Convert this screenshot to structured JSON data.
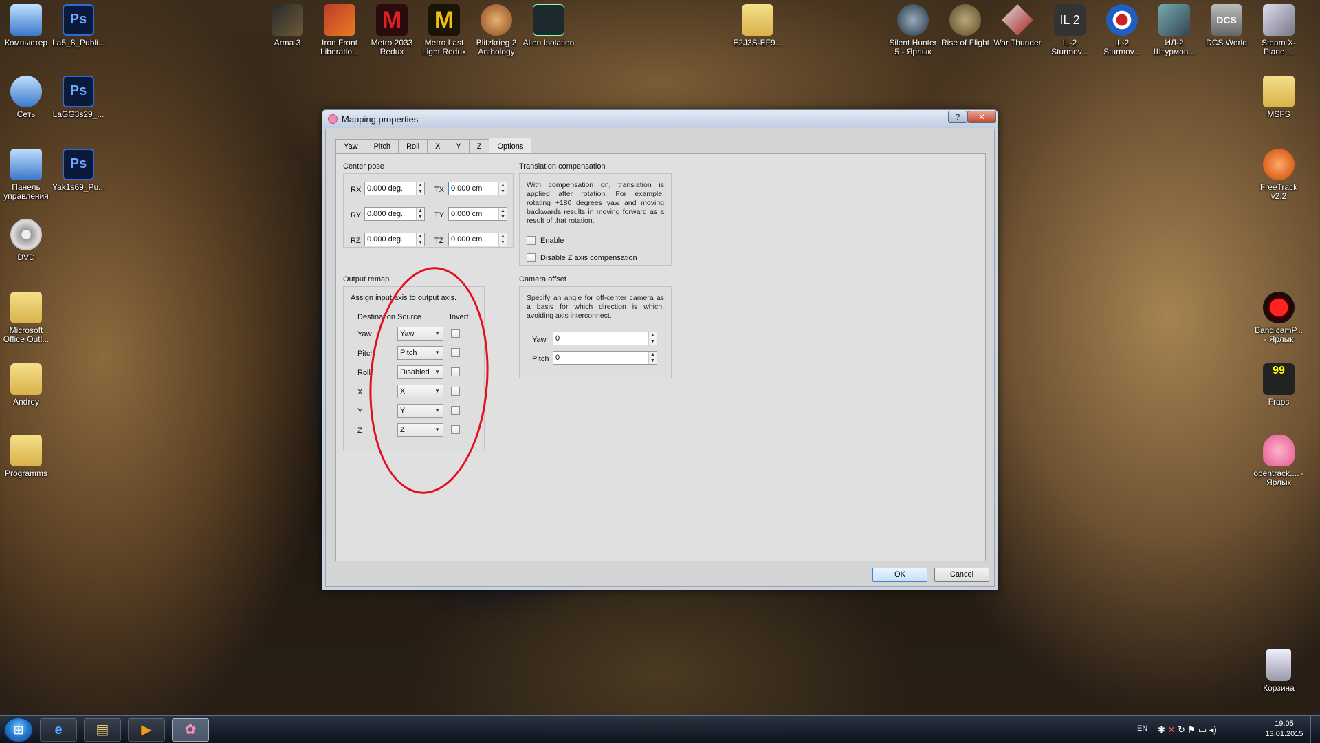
{
  "desktop": {
    "left_icons": [
      {
        "label": "Компьютер",
        "icon": "computer-icon"
      },
      {
        "label": "La5_8_Publi...",
        "icon": "photoshop-psd-icon"
      },
      {
        "label": "Сеть",
        "icon": "network-icon"
      },
      {
        "label": "LaGG3s29_...",
        "icon": "photoshop-psd-icon"
      },
      {
        "label": "Панель управления",
        "icon": "control-panel-icon"
      },
      {
        "label": "Yak1s69_Pu...",
        "icon": "photoshop-psd-icon"
      },
      {
        "label": "DVD",
        "icon": "dvd-drive-icon"
      },
      {
        "label": "Microsoft Office Outl...",
        "icon": "outlook-icon"
      },
      {
        "label": "Andrey",
        "icon": "user-folder-icon"
      },
      {
        "label": "Programms",
        "icon": "folder-icon"
      }
    ],
    "top_icons": [
      {
        "label": "Arma 3",
        "icon": "arma3-icon"
      },
      {
        "label": "Iron Front Liberatio...",
        "icon": "iron-front-icon"
      },
      {
        "label": "Metro 2033 Redux",
        "icon": "metro-2033-icon"
      },
      {
        "label": "Metro Last Light Redux",
        "icon": "metro-last-light-icon"
      },
      {
        "label": "Blitzkrieg 2 Anthology",
        "icon": "blitzkrieg-icon"
      },
      {
        "label": "Alien Isolation",
        "icon": "alien-isolation-icon"
      },
      {
        "label": "E2J3S-EF9...",
        "icon": "folder-icon"
      },
      {
        "label": "Silent Hunter 5 - Ярлык",
        "icon": "silent-hunter-icon"
      },
      {
        "label": "Rise of Flight",
        "icon": "rise-of-flight-icon"
      },
      {
        "label": "War Thunder",
        "icon": "war-thunder-icon"
      },
      {
        "label": "IL-2 Sturmov...",
        "icon": "il2-icon"
      },
      {
        "label": "IL-2 Sturmov...",
        "icon": "il2-roundel-icon"
      },
      {
        "label": "ИЛ-2 Штурмов...",
        "icon": "il2-plane-icon"
      },
      {
        "label": "DCS World",
        "icon": "dcs-icon"
      },
      {
        "label": "Steam X-Plane ...",
        "icon": "xplane-icon"
      }
    ],
    "right_icons": [
      {
        "label": "MSFS",
        "icon": "folder-icon"
      },
      {
        "label": "FreeTrack v2.2",
        "icon": "freetrack-icon"
      },
      {
        "label": "BandicamP... - Ярлык",
        "icon": "bandicam-icon"
      },
      {
        "label": "Fraps",
        "icon": "fraps-icon"
      },
      {
        "label": "opentrack.... - Ярлык",
        "icon": "opentrack-icon"
      },
      {
        "label": "Корзина",
        "icon": "recycle-bin-icon"
      }
    ]
  },
  "dialog": {
    "title": "Mapping properties",
    "help_glyph": "?",
    "close_glyph": "✕",
    "tabs": [
      "Yaw",
      "Pitch",
      "Roll",
      "X",
      "Y",
      "Z",
      "Options"
    ],
    "active_tab": "Options",
    "center_pose": {
      "title": "Center pose",
      "rows": [
        {
          "rot_label": "RX",
          "rot_value": "0.000 deg.",
          "tr_label": "TX",
          "tr_value": "0.000 cm"
        },
        {
          "rot_label": "RY",
          "rot_value": "0.000 deg.",
          "tr_label": "TY",
          "tr_value": "0.000 cm"
        },
        {
          "rot_label": "RZ",
          "rot_value": "0.000 deg.",
          "tr_label": "TZ",
          "tr_value": "0.000 cm"
        }
      ]
    },
    "translation_compensation": {
      "title": "Translation compensation",
      "description": "With compensation on, translation is applied after rotation. For example, rotating +180 degrees yaw and moving backwards results in moving forward as a result of that rotation.",
      "enable_label": "Enable",
      "enable_checked": false,
      "disable_z_label": "Disable Z axis compensation",
      "disable_z_checked": false
    },
    "output_remap": {
      "title": "Output remap",
      "description": "Assign input axis to output axis.",
      "headers": {
        "destination": "Destination",
        "source": "Source",
        "invert": "Invert"
      },
      "rows": [
        {
          "destination": "Yaw",
          "source": "Yaw",
          "invert": false
        },
        {
          "destination": "Pitch",
          "source": "Pitch",
          "invert": false
        },
        {
          "destination": "Roll",
          "source": "Disabled",
          "invert": false
        },
        {
          "destination": "X",
          "source": "X",
          "invert": false
        },
        {
          "destination": "Y",
          "source": "Y",
          "invert": false
        },
        {
          "destination": "Z",
          "source": "Z",
          "invert": false
        }
      ]
    },
    "camera_offset": {
      "title": "Camera offset",
      "description": "Specify an angle for off-center camera as a basis for which direction is which, avoiding axis interconnect.",
      "yaw_label": "Yaw",
      "yaw_value": "0",
      "pitch_label": "Pitch",
      "pitch_value": "0"
    },
    "buttons": {
      "ok": "OK",
      "cancel": "Cancel"
    }
  },
  "taskbar": {
    "items": [
      {
        "icon": "internet-explorer-icon",
        "glyph": "e"
      },
      {
        "icon": "explorer-icon",
        "glyph": "▤"
      },
      {
        "icon": "media-player-icon",
        "glyph": "▶"
      },
      {
        "icon": "opentrack-icon",
        "glyph": "✿"
      }
    ],
    "language": "EN",
    "time": "19:05",
    "date": "13.01.2015"
  },
  "colors": {
    "annotation_circle": "#e01020",
    "dialog_frame": "#c9d4e2",
    "close_button": "#c4472b"
  }
}
